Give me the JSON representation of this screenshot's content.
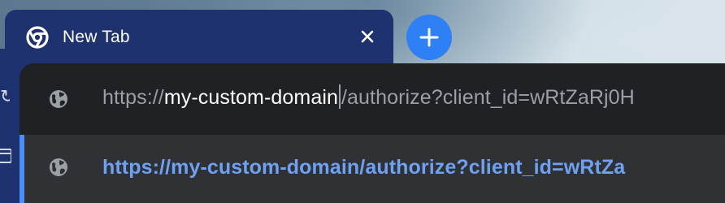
{
  "tab": {
    "title": "New Tab",
    "favicon": "chrome-icon",
    "close_icon": "close-icon"
  },
  "new_tab_button": {
    "icon": "plus-icon"
  },
  "omnibox": {
    "input": {
      "scheme": "https://",
      "host": "my-custom-domain",
      "rest": "/authorize?client_id=wRtZaRj0H",
      "icon": "globe-icon"
    },
    "suggestion": {
      "text": "https://my-custom-domain/authorize?client_id=wRtZa",
      "icon": "globe-icon"
    }
  },
  "colors": {
    "tab_bg": "#1e3270",
    "accent": "#2f7ff5",
    "omnibox_bg": "#202124",
    "suggestion_bg": "#303134",
    "suggestion_text": "#6fa0f2"
  }
}
